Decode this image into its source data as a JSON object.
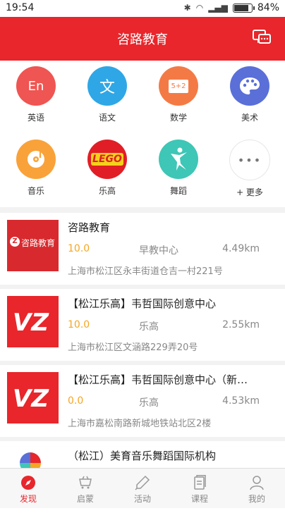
{
  "status": {
    "time": "19:54",
    "battery": "84%"
  },
  "header": {
    "title": "咨路教育"
  },
  "categories": [
    {
      "label": "英语",
      "glyph": "En",
      "color": "#ef5552",
      "icon": "english-icon"
    },
    {
      "label": "语文",
      "glyph": "文",
      "color": "#2fa7e6",
      "icon": "chinese-icon"
    },
    {
      "label": "数学",
      "glyph": "5+2",
      "color": "#f47a45",
      "icon": "math-icon"
    },
    {
      "label": "美术",
      "glyph": "🎨",
      "color": "#5a6fd8",
      "icon": "palette-icon"
    },
    {
      "label": "音乐",
      "glyph": "♫",
      "color": "#f9a23a",
      "icon": "music-icon"
    },
    {
      "label": "乐高",
      "glyph": "LEGO",
      "color": "#e11e26",
      "icon": "lego-icon"
    },
    {
      "label": "舞蹈",
      "glyph": "⚘",
      "color": "#3ec6b6",
      "icon": "dancer-icon"
    },
    {
      "label": "+ 更多",
      "glyph": "•••",
      "color": "#ffffff",
      "icon": "more-icon"
    }
  ],
  "listings": [
    {
      "name": "咨路教育",
      "score": "10.0",
      "category": "早教中心",
      "distance": "4.49km",
      "address": "上海市松江区永丰街道仓吉一村221号",
      "logo": "咨路教育"
    },
    {
      "name": "【松江乐高】韦哲国际创意中心",
      "score": "10.0",
      "category": "乐高",
      "distance": "2.55km",
      "address": "上海市松江区文涵路229弄20号",
      "logo": "VZ"
    },
    {
      "name": "【松江乐高】韦哲国际创意中心（新…",
      "score": "0.0",
      "category": "乐高",
      "distance": "4.53km",
      "address": "上海市嘉松南路新城地铁站北区2楼",
      "logo": "VZ"
    },
    {
      "name": "（松江）美育音乐舞蹈国际机构",
      "score": "",
      "category": "",
      "distance": "",
      "address": "",
      "logo": ""
    }
  ],
  "tabs": [
    {
      "label": "发现",
      "icon": "compass-icon",
      "active": true
    },
    {
      "label": "启蒙",
      "icon": "cart-icon",
      "active": false
    },
    {
      "label": "活动",
      "icon": "pen-icon",
      "active": false
    },
    {
      "label": "课程",
      "icon": "document-icon",
      "active": false
    },
    {
      "label": "我的",
      "icon": "user-icon",
      "active": false
    }
  ]
}
